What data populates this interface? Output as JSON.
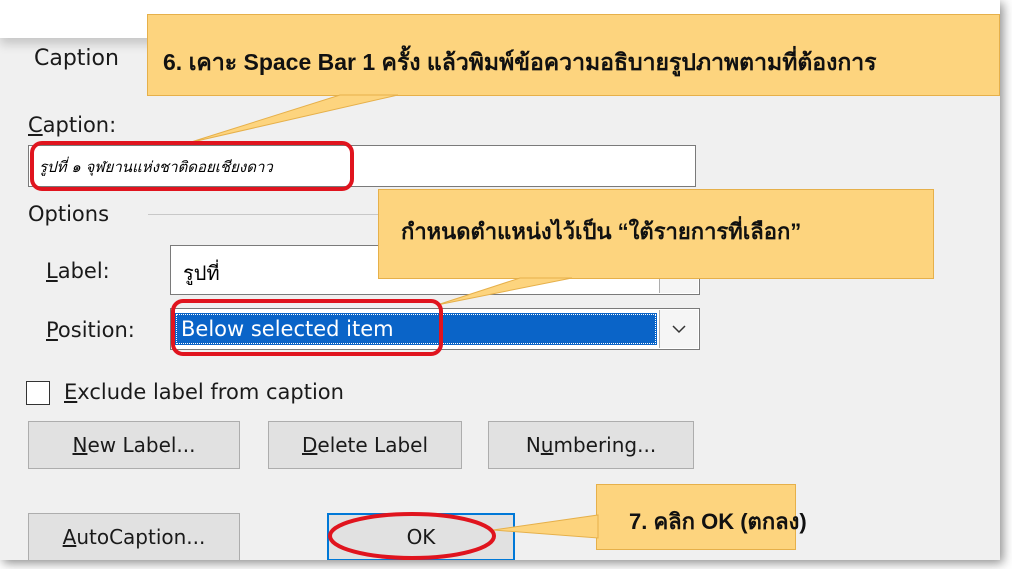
{
  "dialog": {
    "title": "Caption",
    "caption_label": "Caption:",
    "caption_value": "รูปที่ ๑ จุฬยานแห่งชาติดอยเชียงดาว",
    "options_label": "Options",
    "label_label": "Label:",
    "label_value": "รูปที่",
    "position_label": "Position:",
    "position_value": "Below selected item",
    "exclude_label": "Exclude label from caption",
    "exclude_checked": false,
    "buttons": {
      "new_label": "New Label...",
      "delete_label": "Delete Label",
      "numbering": "Numbering...",
      "autocaption": "AutoCaption...",
      "ok": "OK"
    }
  },
  "callouts": {
    "step6": "6. เคาะ Space Bar 1 ครั้ง แล้วพิมพ์ข้อความอธิบายรูปภาพตามที่ต้องการ",
    "position_note": "กำหนดตำแหน่งไว้เป็น “ใต้รายการที่เลือก”",
    "step7": "7. คลิก OK (ตกลง)"
  },
  "colors": {
    "callout_fill": "#fdd47e",
    "highlight_red": "#e0141e",
    "selection_blue": "#0a64c8",
    "dialog_bg": "#f0f0f0"
  },
  "icons": [
    "chevron-down-icon"
  ]
}
